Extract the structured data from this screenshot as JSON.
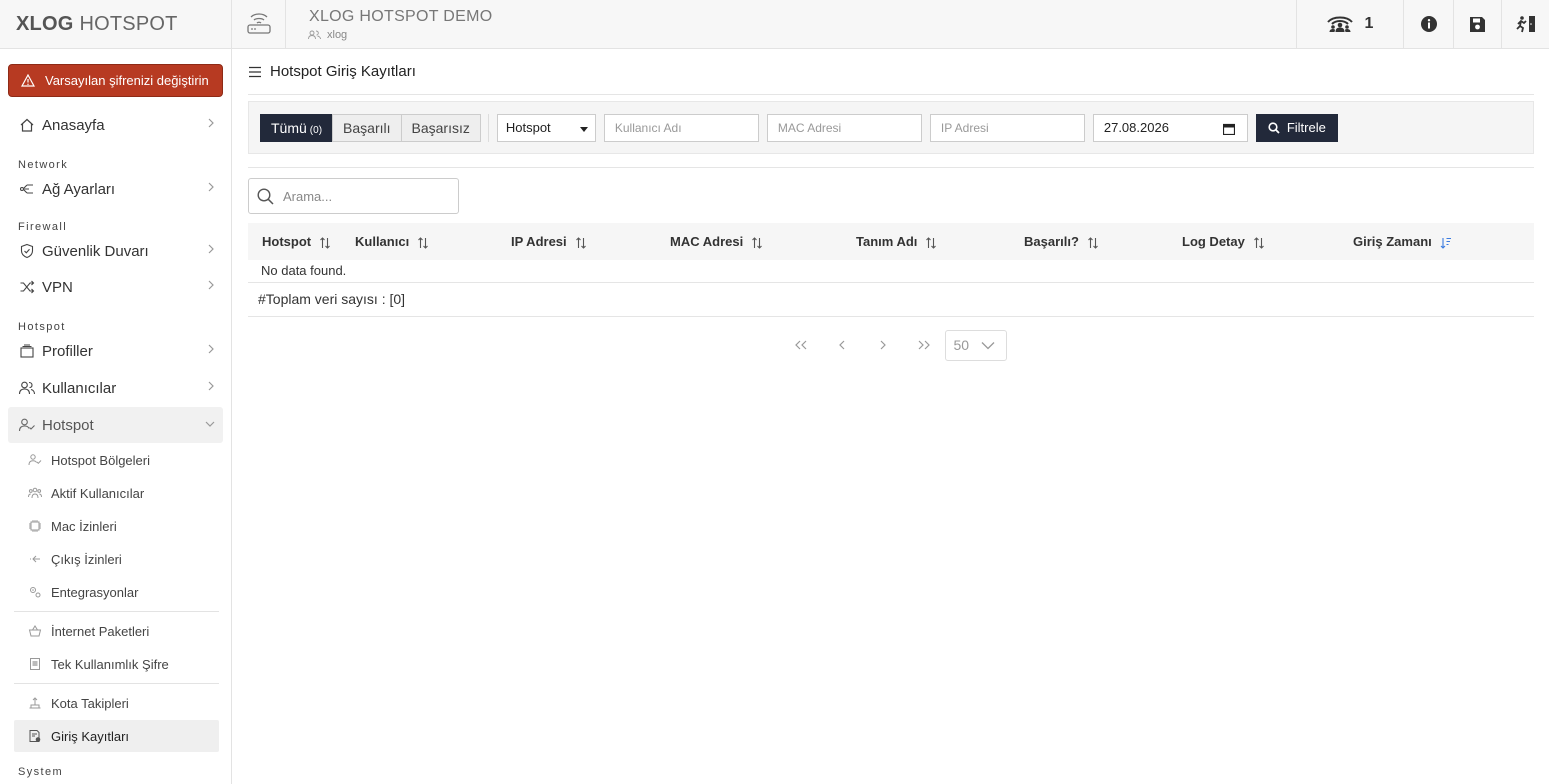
{
  "brand": {
    "part1": "XLOG",
    "part2": "HOTSPOT"
  },
  "alert": {
    "text": "Varsayılan şifrenizi değiştirin"
  },
  "sidebar": {
    "home": "Anasayfa",
    "section_network": "Network",
    "network_settings": "Ağ Ayarları",
    "section_firewall": "Firewall",
    "firewall": "Güvenlik Duvarı",
    "vpn": "VPN",
    "section_hotspot": "Hotspot",
    "profiles": "Profiller",
    "users": "Kullanıcılar",
    "hotspot": "Hotspot",
    "sub": {
      "zones": "Hotspot Bölgeleri",
      "active_users": "Aktif Kullanıcılar",
      "mac_permits": "Mac İzinleri",
      "exit_permits": "Çıkış İzinleri",
      "integrations": "Entegrasyonlar",
      "internet_packages": "İnternet Paketleri",
      "otp": "Tek Kullanımlık Şifre",
      "quota": "Kota Takipleri",
      "login_logs": "Giriş Kayıtları"
    },
    "section_system": "System"
  },
  "topbar": {
    "title": "XLOG HOTSPOT DEMO",
    "subtitle": "xlog",
    "active_users_count": "1"
  },
  "page": {
    "title": "Hotspot Giriş Kayıtları"
  },
  "filters": {
    "tab_all": "Tümü",
    "tab_all_count": "(0)",
    "tab_success": "Başarılı",
    "tab_fail": "Başarısız",
    "hotspot_select": "Hotspot",
    "username_placeholder": "Kullanıcı Adı",
    "mac_placeholder": "MAC Adresi",
    "ip_placeholder": "IP Adresi",
    "date": "27.08.2026",
    "filter_button": "Filtrele"
  },
  "search": {
    "placeholder": "Arama..."
  },
  "table": {
    "columns": [
      "Hotspot",
      "Kullanıcı",
      "IP Adresi",
      "MAC Adresi",
      "Tanım Adı",
      "Başarılı?",
      "Log Detay",
      "Giriş Zamanı"
    ],
    "empty": "No data found.",
    "total": "#Toplam veri sayısı : [0]"
  },
  "pager": {
    "page_size": "50"
  }
}
